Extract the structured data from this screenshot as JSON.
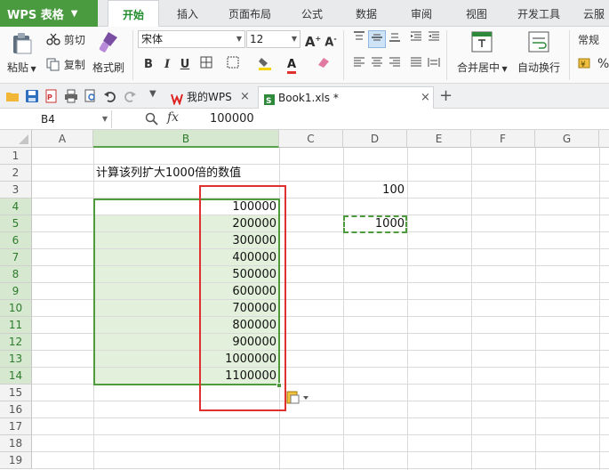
{
  "app": {
    "name": "WPS 表格"
  },
  "menu_tabs": [
    "开始",
    "插入",
    "页面布局",
    "公式",
    "数据",
    "审阅",
    "视图",
    "开发工具",
    "云服务"
  ],
  "ribbon": {
    "paste": "粘贴",
    "cut": "剪切",
    "copy": "复制",
    "format_painter": "格式刷",
    "font_name": "宋体",
    "font_size": "12",
    "bold": "B",
    "italic": "I",
    "underline": "U",
    "merge_center": "合并居中",
    "wrap_text": "自动换行",
    "number_format": "常规"
  },
  "doc_tabs": [
    {
      "label": "我的WPS"
    },
    {
      "label": "Book1.xls *"
    }
  ],
  "formula_bar": {
    "name_box": "B4",
    "fx": "fx",
    "value": "100000"
  },
  "columns": [
    "A",
    "B",
    "C",
    "D",
    "E",
    "F",
    "G"
  ],
  "rows": [
    "1",
    "2",
    "3",
    "4",
    "5",
    "6",
    "7",
    "8",
    "9",
    "10",
    "11",
    "12",
    "13",
    "14",
    "15",
    "16",
    "17",
    "18",
    "19"
  ],
  "cells": {
    "B2": "计算该列扩大1000倍的数值",
    "D3": "100",
    "D5": "1000",
    "B_values": [
      "100000",
      "200000",
      "300000",
      "400000",
      "500000",
      "600000",
      "700000",
      "800000",
      "900000",
      "1000000",
      "1100000"
    ]
  },
  "colors": {
    "accent_green": "#4a9b3f",
    "selection_fill": "#e3f1dc",
    "selection_border": "#4f9a3d",
    "highlight_red": "#e0312f"
  }
}
